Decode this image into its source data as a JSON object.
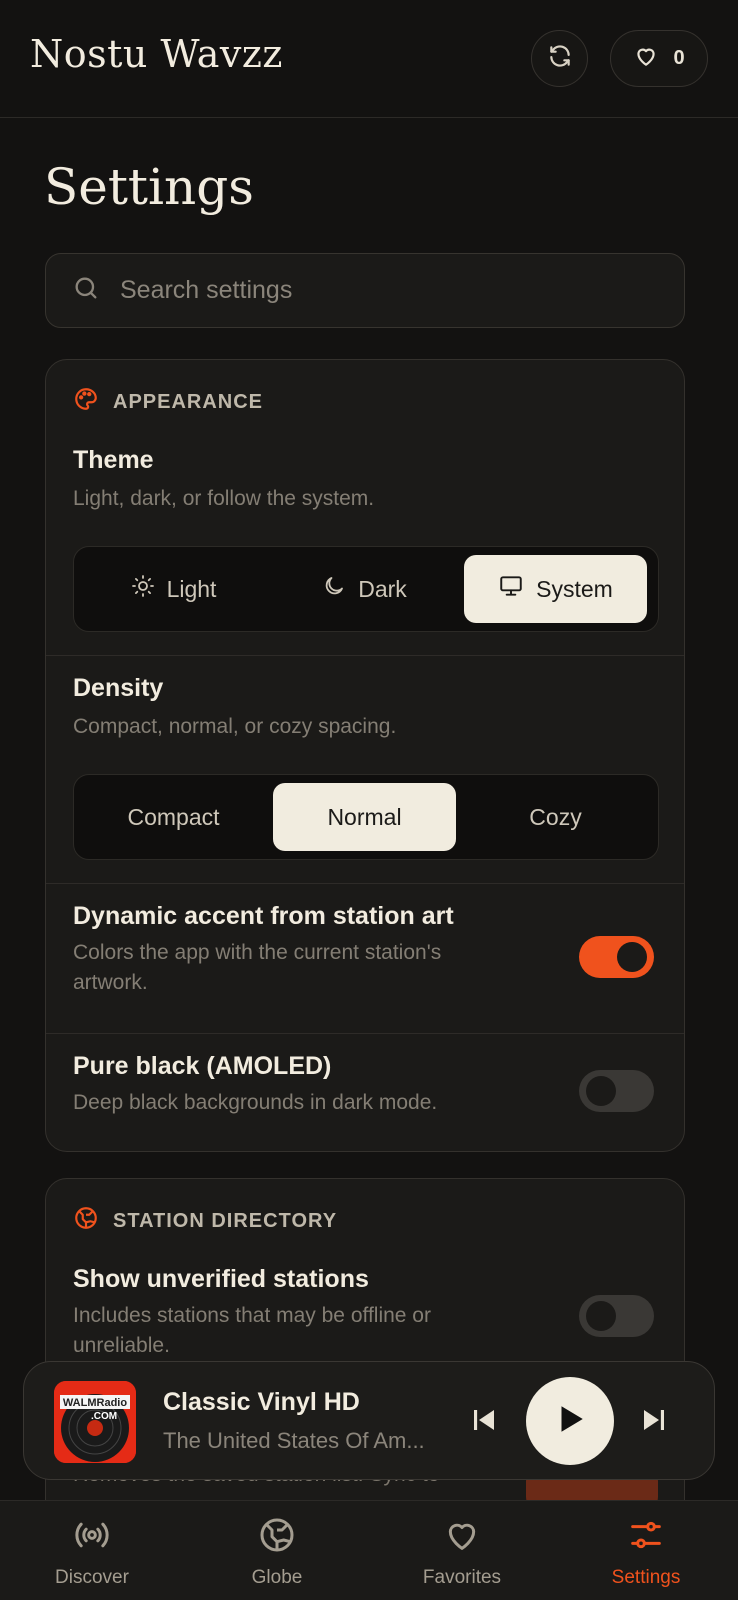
{
  "app": {
    "title": "Nostu Wavzz",
    "favorites_count": "0"
  },
  "page": {
    "title": "Settings"
  },
  "search": {
    "placeholder": "Search settings"
  },
  "appearance": {
    "heading": "APPEARANCE",
    "theme": {
      "title": "Theme",
      "description": "Light, dark, or follow the system.",
      "options": [
        "Light",
        "Dark",
        "System"
      ],
      "selected": "System"
    },
    "density": {
      "title": "Density",
      "description": "Compact, normal, or cozy spacing.",
      "options": [
        "Compact",
        "Normal",
        "Cozy"
      ],
      "selected": "Normal"
    },
    "dynamic_accent": {
      "title": "Dynamic accent from station art",
      "description": "Colors the app with the current station's artwork.",
      "enabled": true
    },
    "pure_black": {
      "title": "Pure black (AMOLED)",
      "description": "Deep black backgrounds in dark mode.",
      "enabled": false
    }
  },
  "directory": {
    "heading": "STATION DIRECTORY",
    "show_unverified": {
      "title": "Show unverified stations",
      "description": "Includes stations that may be offline or unreliable.",
      "enabled": false
    },
    "partial_text": "Removes the saved station list. Sync to"
  },
  "now_playing": {
    "title": "Classic Vinyl HD",
    "subtitle": "The United States Of Am...",
    "art_text_1": "WALMRadio",
    "art_text_2": ".COM"
  },
  "nav": {
    "items": [
      "Discover",
      "Globe",
      "Favorites",
      "Settings"
    ],
    "active": "Settings"
  },
  "colors": {
    "accent": "#f0521d",
    "background": "#131211",
    "card": "#1b1a18",
    "cream": "#f1ecdf"
  }
}
